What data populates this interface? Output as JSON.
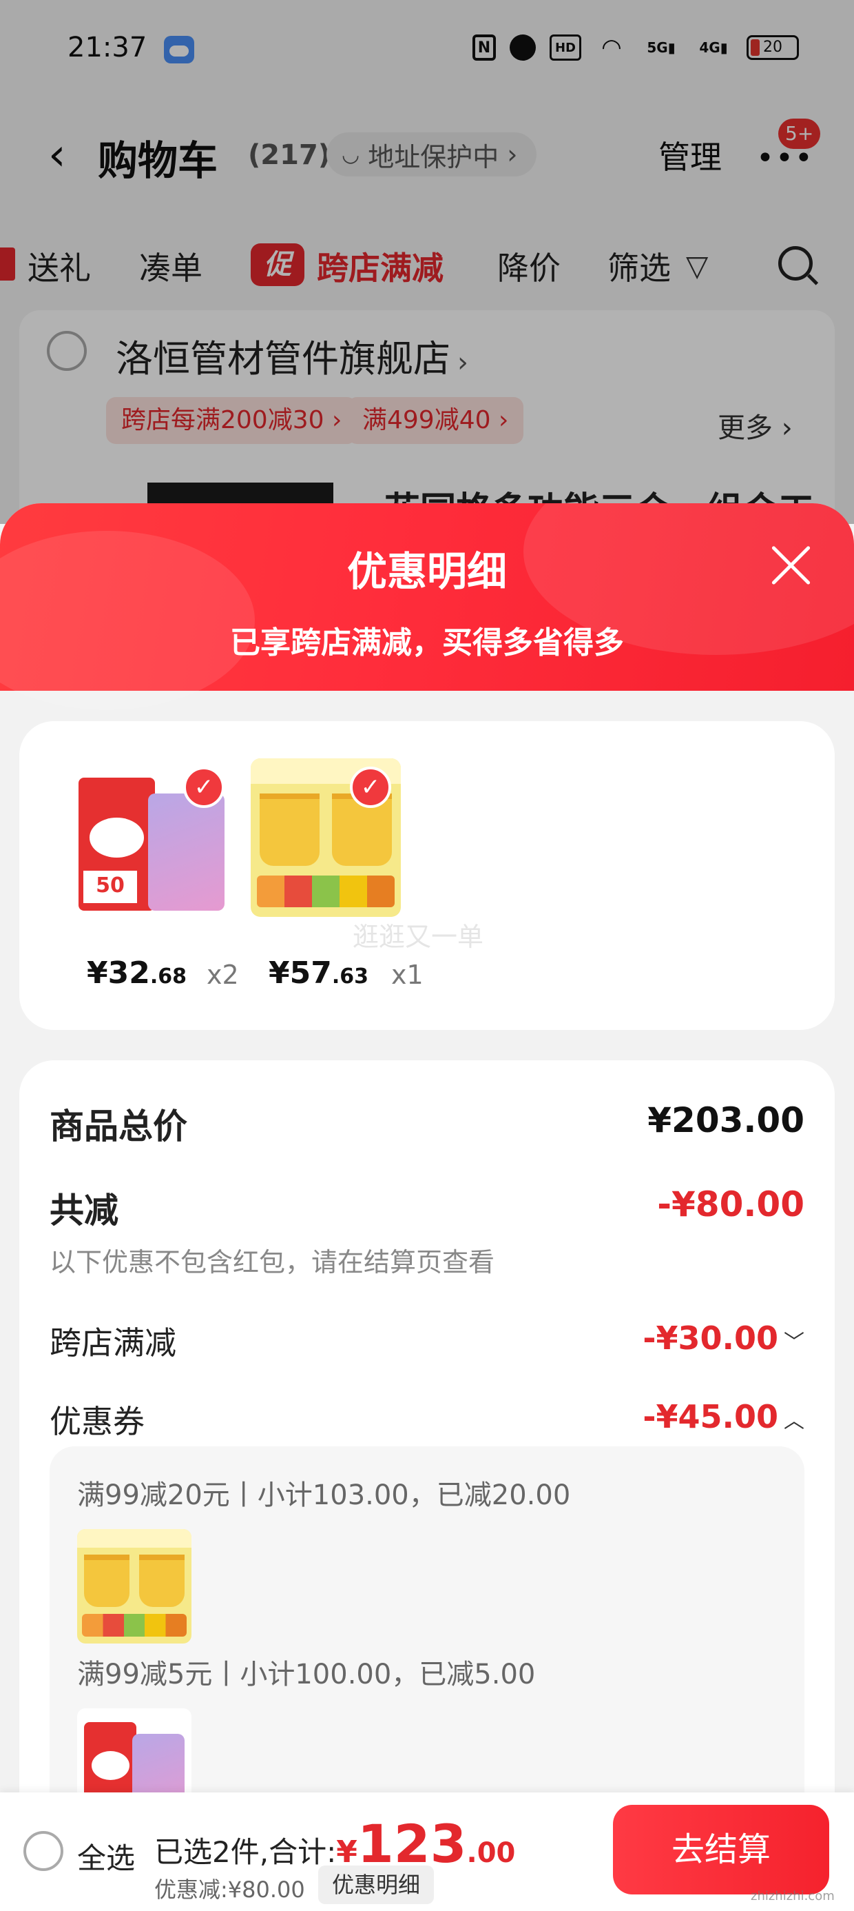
{
  "status_bar": {
    "time": "21:37",
    "battery": "20",
    "icons": [
      "weather-icon",
      "nfc-icon",
      "alarm-icon",
      "hd-icon",
      "wifi-icon",
      "5g-signal-icon",
      "4g-signal-icon",
      "battery-icon"
    ]
  },
  "nav": {
    "title": "购物车",
    "count": "(217)",
    "address_chip": "地址保护中",
    "manage": "管理",
    "badge": "5+"
  },
  "filters": {
    "items": [
      "送礼",
      "凑单",
      "跨店满减",
      "降价",
      "筛选"
    ],
    "promo_tag": "促"
  },
  "store": {
    "name": "洛恒管材管件旗舰店",
    "coupons": [
      "跨店每满200减30 ›",
      "满499减40 ›"
    ],
    "more": "更多",
    "peek_title": "花园格多功能三合一组合工"
  },
  "sheet": {
    "title": "优惠明细",
    "subtitle": "已享跨店满减，买得多省得多",
    "items": [
      {
        "price_int": "¥32",
        "price_dec": ".68",
        "qty": "x2",
        "thumb_tag": "50"
      },
      {
        "price_int": "¥57",
        "price_dec": ".63",
        "qty": "x1"
      }
    ],
    "watermark": "逛逛又一单",
    "summary": {
      "total_label": "商品总价",
      "total_value": "¥203.00",
      "discount_label": "共减",
      "discount_value": "-¥80.00",
      "note": "以下优惠不包含红包，请在结算页查看",
      "cross_store_label": "跨店满减",
      "cross_store_value": "-¥30.00",
      "coupon_label": "优惠券",
      "coupon_value": "-¥45.00"
    },
    "coupon_details": [
      "满99减20元丨小计103.00，已减20.00",
      "满99减5元丨小计100.00，已减5.00"
    ]
  },
  "bottom_bar": {
    "select_all": "全选",
    "selected_text": "已选2件,合计:",
    "currency": "¥",
    "total_int": "123",
    "total_dec": ".00",
    "discount": "优惠减:¥80.00",
    "detail_button": "优惠明细",
    "checkout": "去结算"
  },
  "site_watermark": "zhizhizhi.com",
  "colors": {
    "accent": "#e3282d",
    "header_gradient": "#ff3b3f"
  }
}
